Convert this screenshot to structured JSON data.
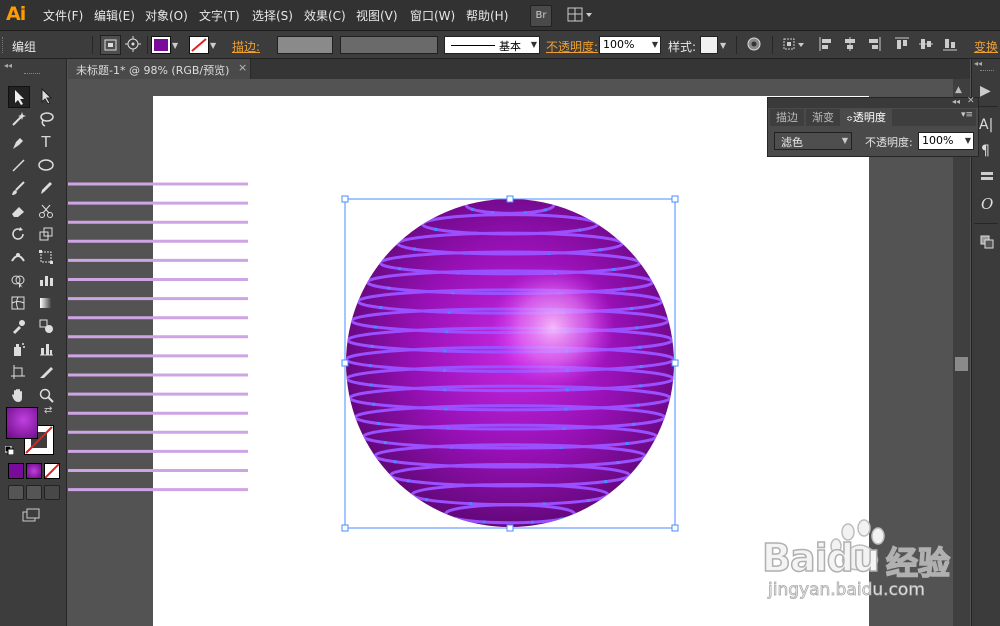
{
  "app": {
    "logo": "Ai",
    "accent": "#ff9a00"
  },
  "menu": [
    "文件(F)",
    "编辑(E)",
    "对象(O)",
    "文字(T)",
    "选择(S)",
    "效果(C)",
    "视图(V)",
    "窗口(W)",
    "帮助(H)"
  ],
  "menubar_buttons": {
    "bridge": "Br"
  },
  "control": {
    "selection_label": "编组",
    "fill_color": "#7a0a9a",
    "stroke_label": "描边:",
    "stroke_profile": "基本",
    "opacity_label": "不透明度:",
    "opacity_value": "100%",
    "style_label": "样式:",
    "transform_label": "变换"
  },
  "document": {
    "tab_title": "未标题-1* @ 98% (RGB/预览)",
    "close": "×"
  },
  "transparency_panel": {
    "tabs": [
      "描边",
      "渐变",
      "透明度"
    ],
    "active_tab": "透明度",
    "blend_mode": "滤色",
    "opacity_label": "不透明度:",
    "opacity_value": "100%"
  },
  "artwork": {
    "line_color": "#cfa4e4",
    "line_count": 17,
    "sphere_dark": "#6a0a82",
    "sphere_mid": "#a020c0",
    "sphere_highlight": "#f6b4ff",
    "stripe_color": "#9a50ff",
    "selection_color": "#4a8cff"
  },
  "watermark": {
    "brand": "Baidu",
    "cn": "经验",
    "url": "jingyan.baidu.com"
  }
}
